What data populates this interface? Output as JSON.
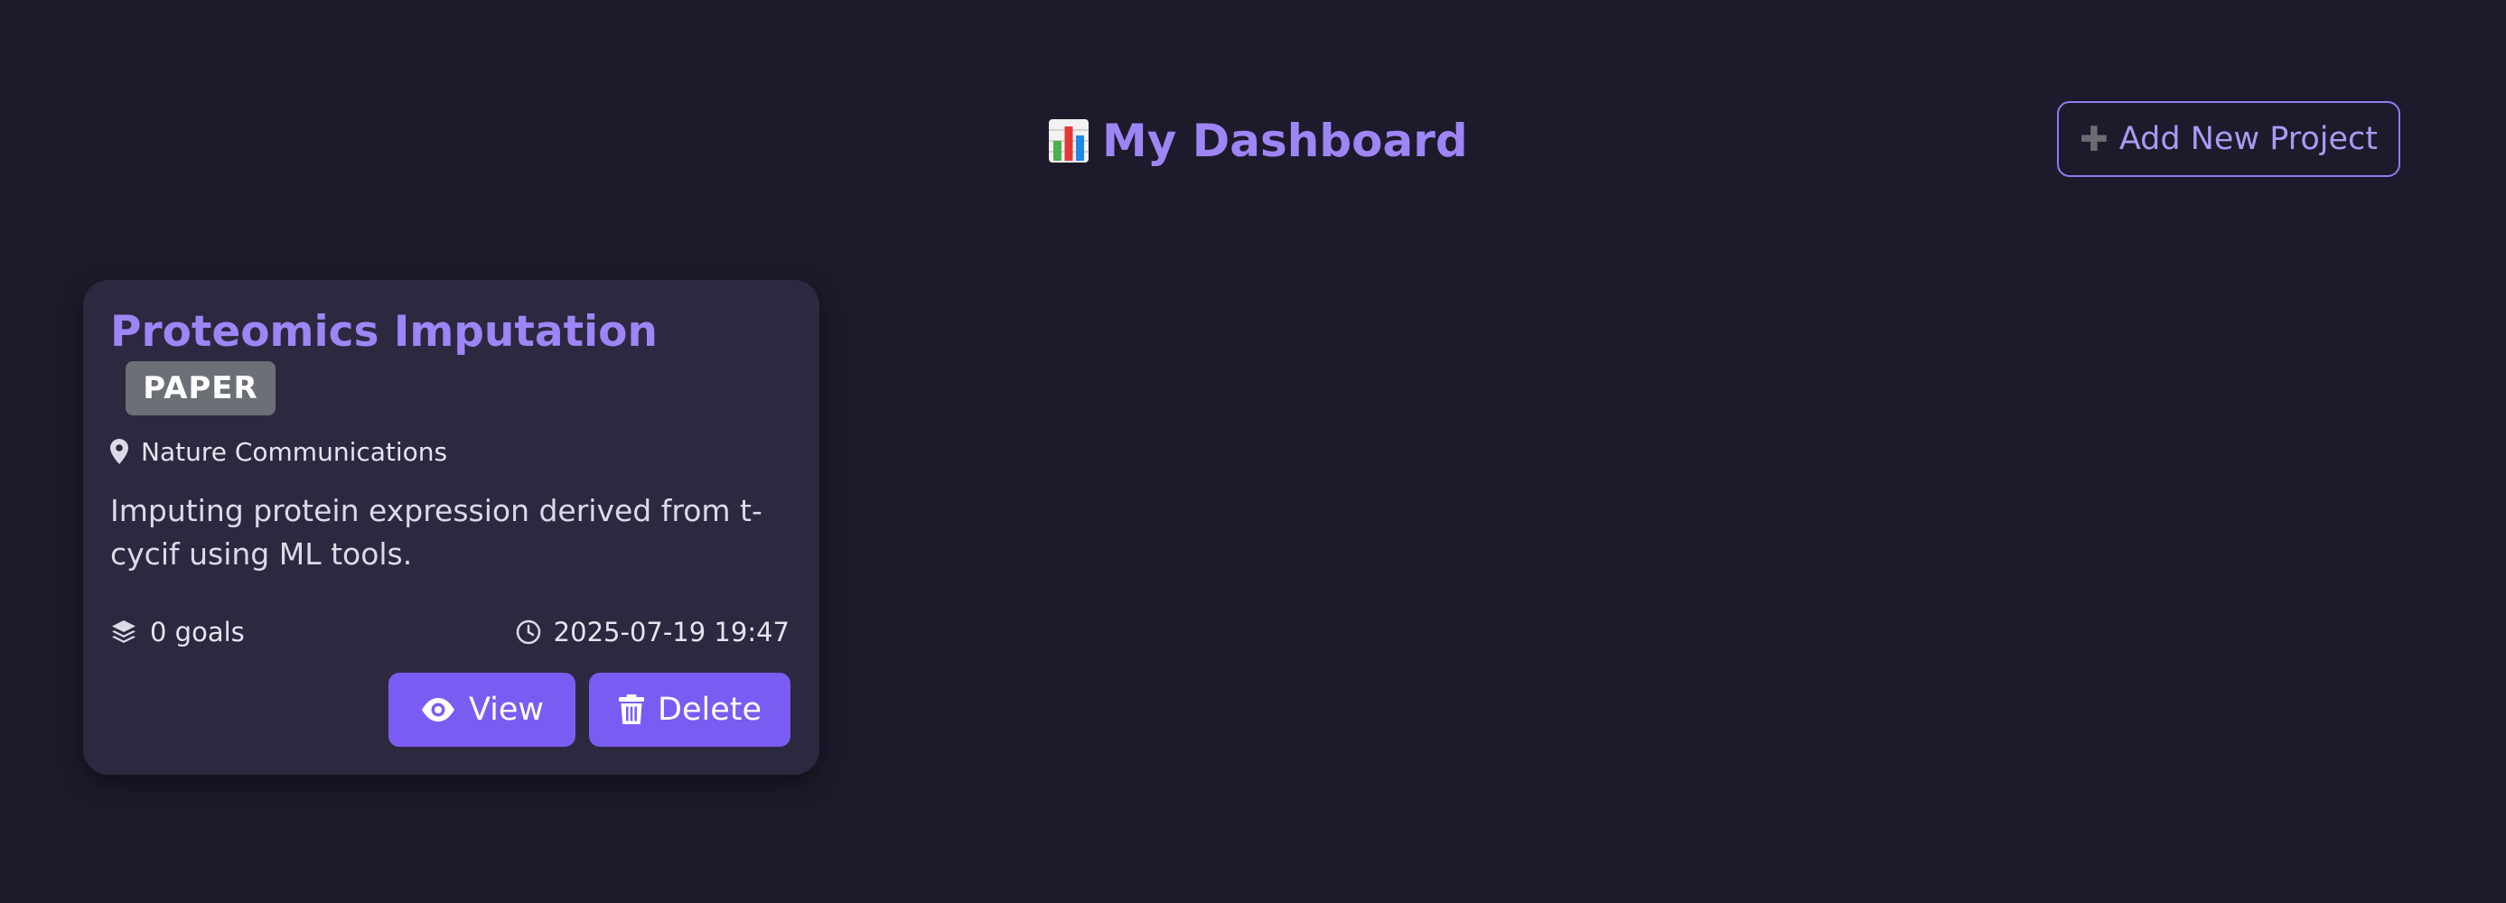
{
  "header": {
    "title": "My Dashboard",
    "title_icon": "bar-chart-emoji-icon",
    "add_button_label": "Add New Project",
    "add_button_icon": "plus-icon"
  },
  "projects": [
    {
      "title": "Proteomics Imputation",
      "type_badge": "PAPER",
      "venue": "Nature Communications",
      "venue_icon": "map-marker-icon",
      "description": "Imputing protein expression derived from t-cycif using ML tools.",
      "goals": "0 goals",
      "goals_icon": "layers-icon",
      "timestamp": "2025-07-19 19:47",
      "timestamp_icon": "clock-icon",
      "view_label": "View",
      "view_icon": "eye-icon",
      "delete_label": "Delete",
      "delete_icon": "trash-icon"
    }
  ],
  "colors": {
    "background": "#1d1a2b",
    "card": "#2c2840",
    "accent": "#9d85f5",
    "button": "#7a5cf2",
    "badge": "#6b6f76"
  }
}
